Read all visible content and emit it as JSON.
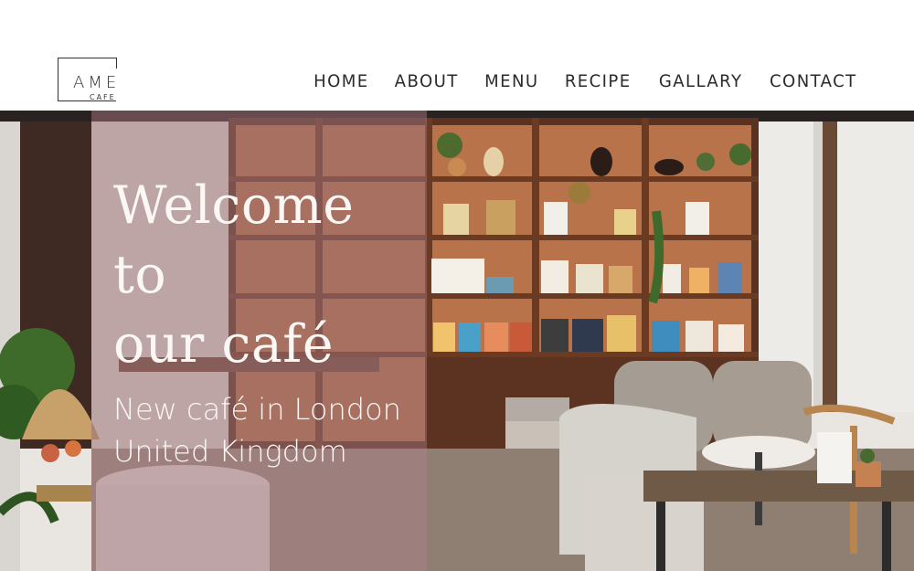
{
  "brand": {
    "name": "AME",
    "sub": "CAFE"
  },
  "nav": {
    "items": [
      {
        "label": "HOME"
      },
      {
        "label": "ABOUT"
      },
      {
        "label": "MENU"
      },
      {
        "label": "RECIPE"
      },
      {
        "label": "GALLARY"
      },
      {
        "label": "CONTACT"
      }
    ]
  },
  "hero": {
    "title_line1": "Welcome to",
    "title_line2": "our café",
    "subtitle_line1": "New café in London",
    "subtitle_line2": "United Kingdom"
  },
  "colors": {
    "overlay": "#996e74",
    "wood": "#6b3f26",
    "floor": "#9c8c80"
  }
}
